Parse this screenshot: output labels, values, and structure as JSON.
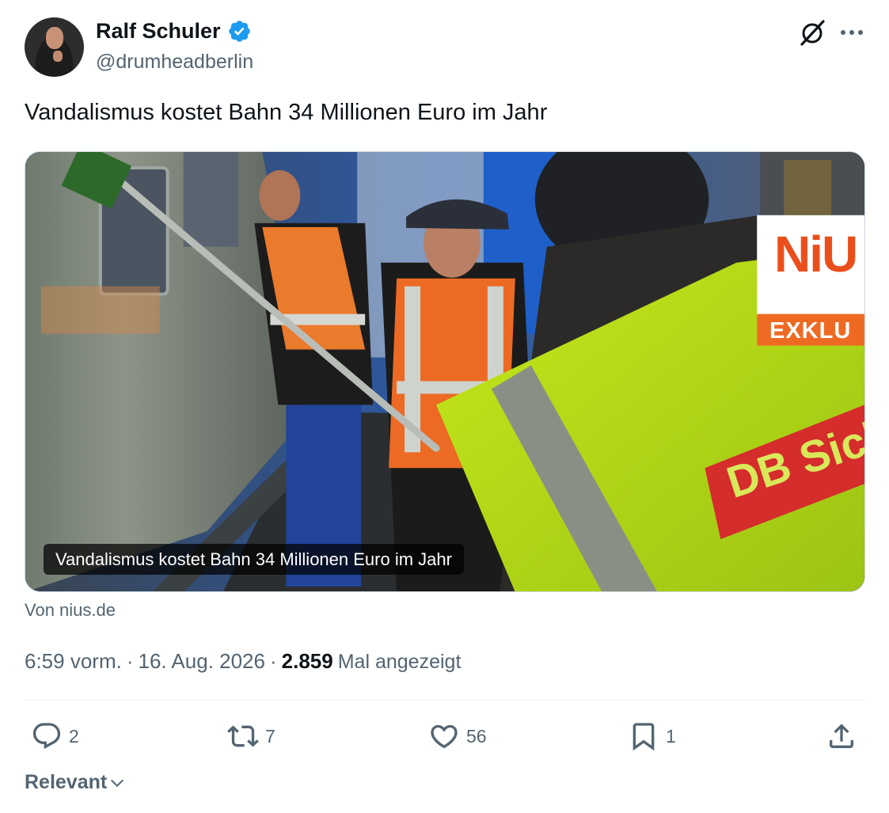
{
  "author": {
    "name": "Ralf Schuler",
    "handle": "@drumheadberlin"
  },
  "tweet": {
    "text": "Vandalismus kostet Bahn 34 Millionen Euro im Jahr"
  },
  "card": {
    "caption": "Vandalismus kostet Bahn 34 Millionen Euro im Jahr",
    "source": "Von nius.de",
    "badge_logo": "NiU",
    "badge_banner": "EXKLU",
    "vest_text": "DB Sich"
  },
  "meta": {
    "time": "6:59 vorm.",
    "sep1": "·",
    "date": "16. Aug. 2026",
    "sep2": "·",
    "views": "2.859",
    "views_label": "Mal angezeigt"
  },
  "actions": {
    "replies": "2",
    "reposts": "7",
    "likes": "56",
    "bookmarks": "1"
  },
  "sort": {
    "label": "Relevant"
  },
  "icons": [
    "verified-badge-icon",
    "grok-icon",
    "more-icon",
    "reply-icon",
    "repost-icon",
    "like-icon",
    "bookmark-icon",
    "share-icon",
    "chevron-down-icon"
  ],
  "colors": {
    "verified": "#1d9bf0",
    "text_primary": "#0f1419",
    "text_secondary": "#536471",
    "divider": "#eff3f4"
  }
}
